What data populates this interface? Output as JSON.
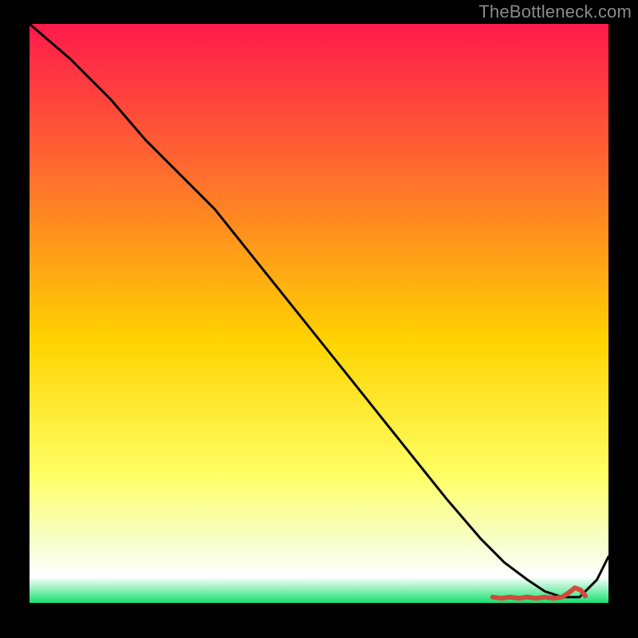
{
  "attribution": "TheBottleneck.com",
  "chart_data": {
    "type": "line",
    "title": "",
    "xlabel": "",
    "ylabel": "",
    "xlim": [
      0,
      100
    ],
    "ylim": [
      0,
      100
    ],
    "grid": false,
    "legend": false,
    "background_gradient": {
      "stops": [
        {
          "offset": 0.0,
          "color": "#ff1a4b"
        },
        {
          "offset": 0.25,
          "color": "#ff6a2f"
        },
        {
          "offset": 0.55,
          "color": "#ffd400"
        },
        {
          "offset": 0.78,
          "color": "#ffff66"
        },
        {
          "offset": 0.9,
          "color": "#f6ffcf"
        },
        {
          "offset": 0.955,
          "color": "#ffffff"
        },
        {
          "offset": 1.0,
          "color": "#17e070"
        }
      ]
    },
    "series": [
      {
        "name": "curve",
        "color": "#000000",
        "x": [
          0,
          7,
          14,
          20,
          26,
          32,
          40,
          48,
          56,
          64,
          72,
          78,
          82,
          86,
          89,
          92,
          95,
          98,
          100
        ],
        "y": [
          100,
          94,
          87,
          80,
          74,
          68,
          58,
          48,
          38,
          28,
          18,
          11,
          7,
          4,
          2,
          1,
          1,
          4,
          8
        ]
      }
    ],
    "markers": {
      "name": "bottom-squiggle",
      "color": "#d24a3a",
      "x": [
        80,
        81.5,
        83,
        84.5,
        86,
        87.5,
        89,
        90.5,
        92,
        93.2,
        94.2,
        95.2,
        96
      ],
      "y": [
        1.0,
        0.8,
        1.0,
        0.8,
        1.0,
        0.8,
        1.0,
        0.8,
        1.0,
        1.8,
        2.6,
        2.2,
        1.2
      ]
    }
  }
}
